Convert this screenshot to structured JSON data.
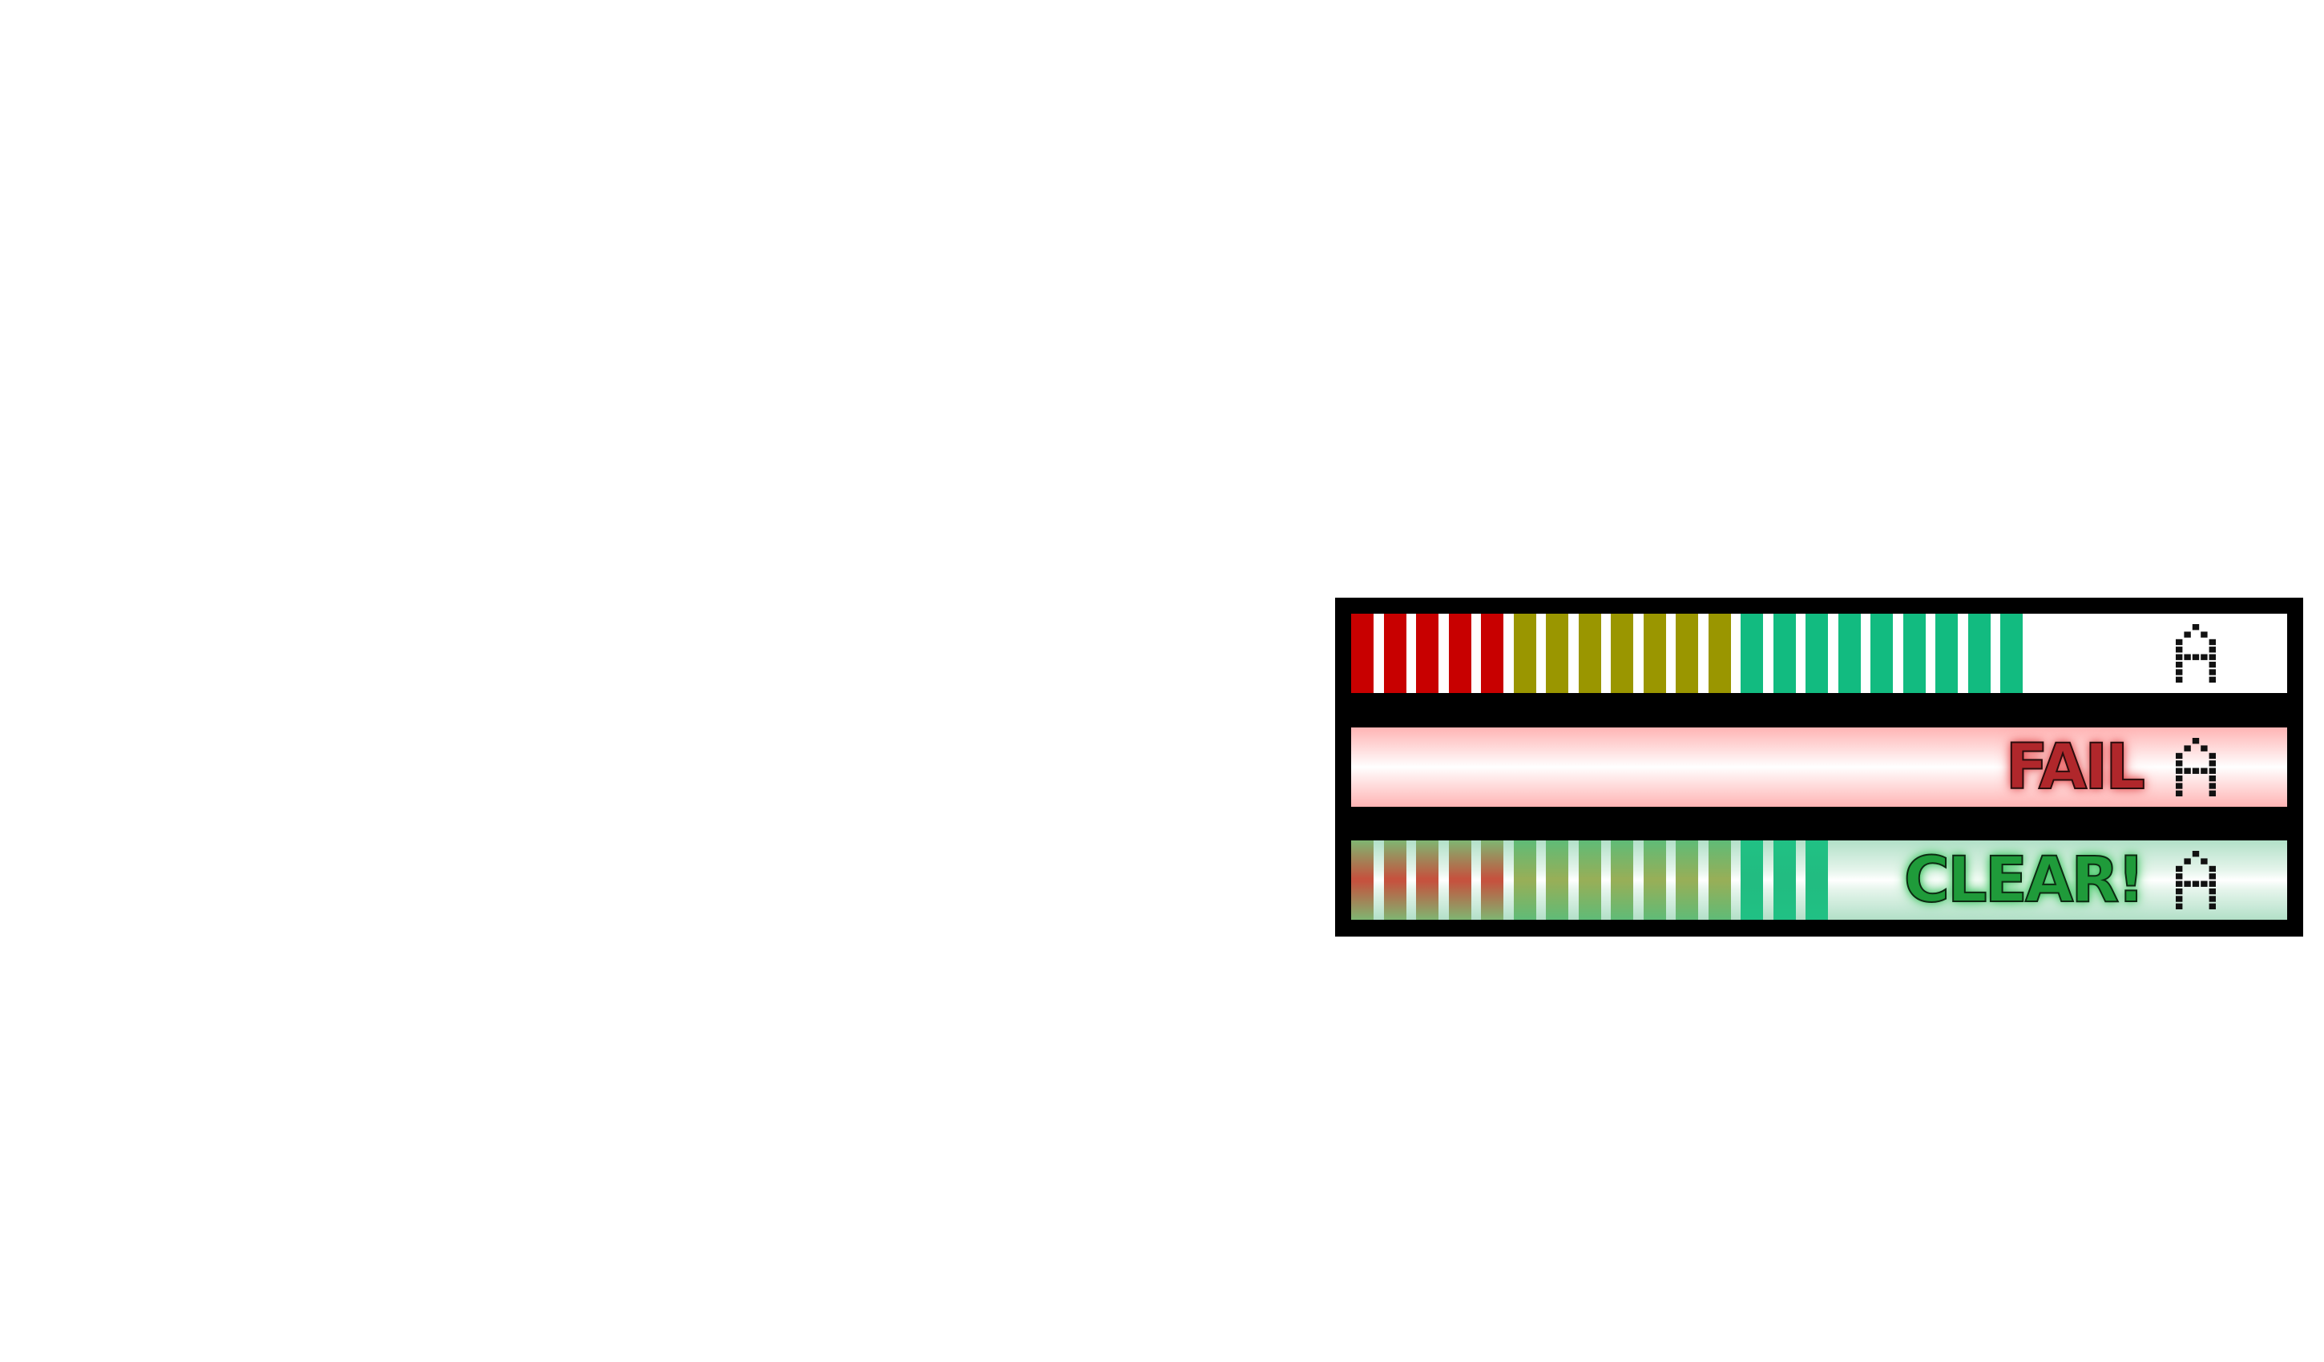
{
  "gauge": {
    "colors": {
      "red": "#c80000",
      "yellow": "#9a9600",
      "green": "#12bb80",
      "panel": "#000000"
    },
    "segment_groups": {
      "red": 5,
      "yellow": 7,
      "green": 9
    },
    "progress_bar": {
      "filled_segments": 21,
      "total_segments": 21,
      "grade_icon": "pixel-letter-a-icon"
    },
    "fail_bar": {
      "label": "FAIL",
      "filled_segments": 0,
      "grade_icon": "pixel-letter-a-icon"
    },
    "clear_bar": {
      "label": "CLEAR!",
      "filled_segments": 15,
      "grade_icon": "pixel-letter-a-icon"
    }
  }
}
